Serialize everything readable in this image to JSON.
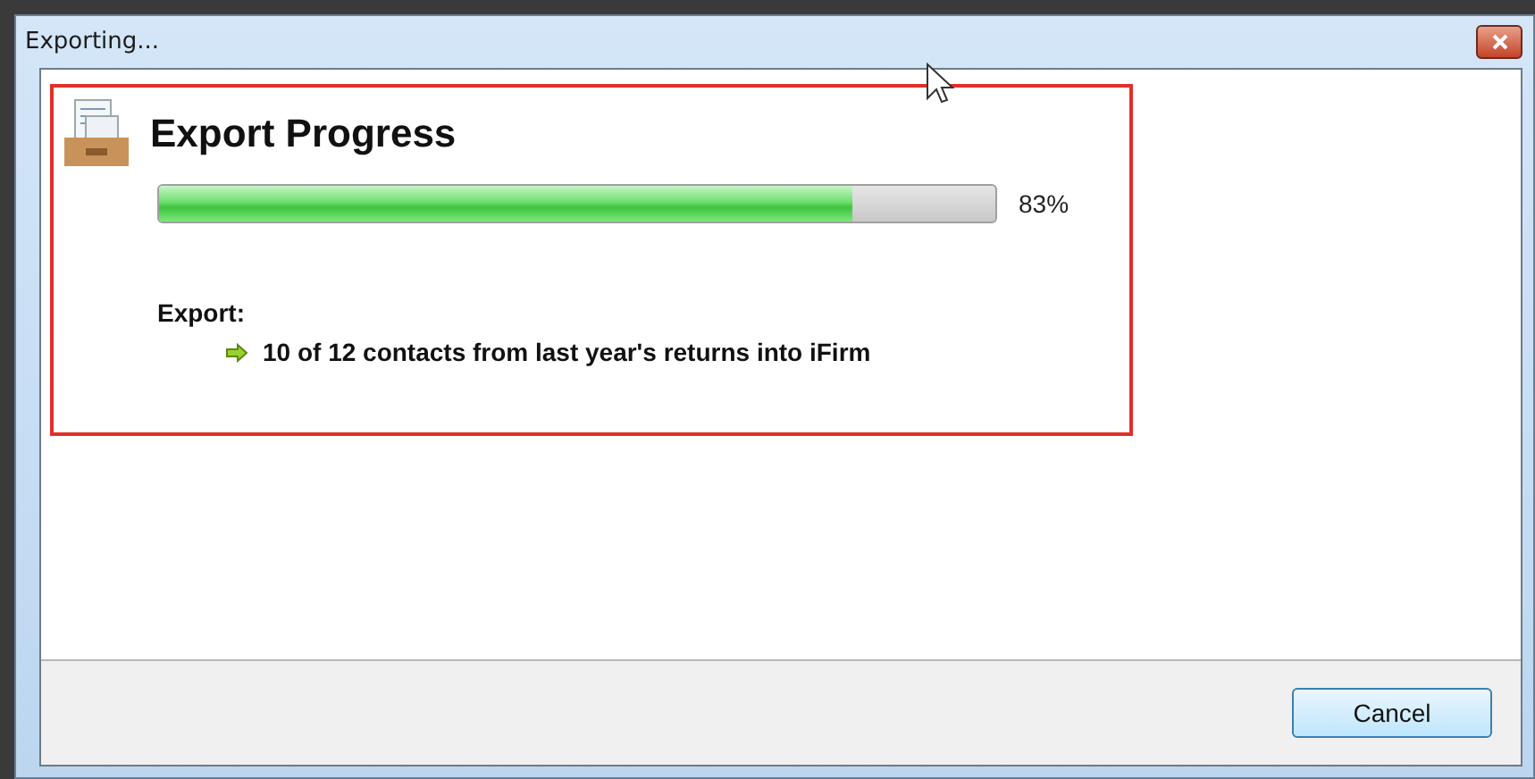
{
  "window": {
    "title": "Exporting..."
  },
  "header": {
    "title": "Export Progress"
  },
  "progress": {
    "level": 0.83,
    "reading": "83%"
  },
  "export": {
    "label": "Export:",
    "items": [
      "10 of 12 contacts from last year's returns into iFirm"
    ]
  },
  "buttons": [
    "Cancel"
  ]
}
